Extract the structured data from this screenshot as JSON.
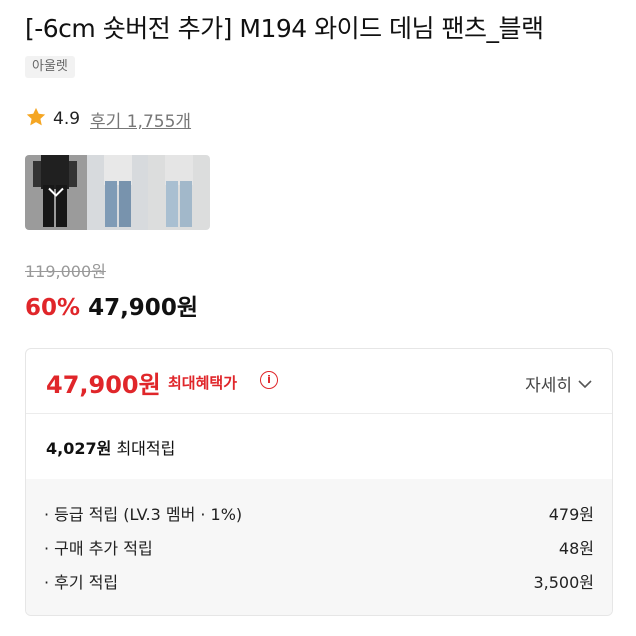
{
  "product": {
    "title": "[-6cm 숏버전 추가] M194 와이드 데님 팬츠_블랙",
    "badge": "아울렛",
    "rating": "4.9",
    "reviews_label": "후기 1,755개",
    "original_price": "119,000원",
    "discount": "60%",
    "price": "47,900원"
  },
  "benefit": {
    "max_price": "47,900원",
    "max_label": "최대혜택가",
    "info_icon": "info-icon",
    "detail_label": "자세히",
    "points_amount": "4,027원",
    "points_label": "최대적립",
    "items": [
      {
        "label": "· 등급 적립 (LV.3 멤버 · 1%)",
        "value": "479원"
      },
      {
        "label": "· 구매 추가 적립",
        "value": "48원"
      },
      {
        "label": "· 후기 적립",
        "value": "3,500원"
      }
    ]
  },
  "colors": {
    "accent_red": "#e0262a",
    "star": "#f5a623"
  }
}
